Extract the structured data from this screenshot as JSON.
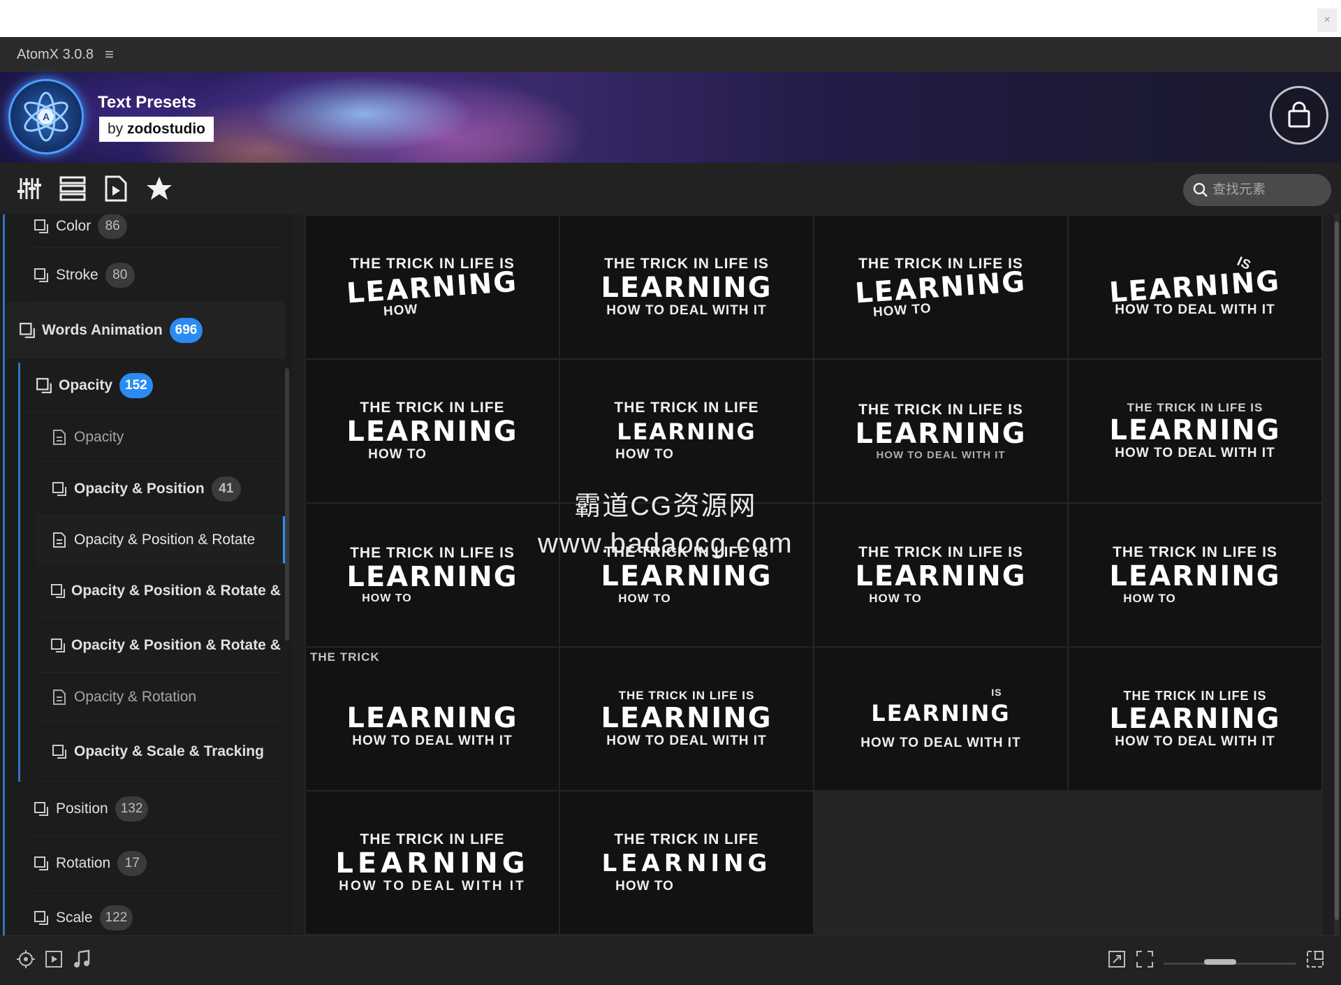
{
  "app": {
    "title": "AtomX 3.0.8",
    "menu_icon": "hamburger-icon"
  },
  "banner": {
    "title": "Text Presets",
    "by_prefix": "by",
    "author": "zodostudio",
    "logo_icon": "atom-logo-icon",
    "cart_icon": "shopping-bag-icon"
  },
  "toolbar": {
    "icons": [
      "sliders-icon",
      "list-icon",
      "file-play-icon",
      "star-icon"
    ],
    "search_placeholder": "查找元素"
  },
  "sidebar": {
    "items": [
      {
        "label": "Color",
        "count": "86"
      },
      {
        "label": "Stroke",
        "count": "80"
      },
      {
        "label": "Words Animation",
        "count": "696"
      },
      {
        "label": "Opacity",
        "count": "152"
      },
      {
        "label": "Opacity",
        "count": ""
      },
      {
        "label": "Opacity & Position",
        "count": "41"
      },
      {
        "label": "Opacity & Position & Rotate",
        "count": ""
      },
      {
        "label": "Opacity & Position & Rotate & ...",
        "count": ""
      },
      {
        "label": "Opacity & Position & Rotate & ...",
        "count": ""
      },
      {
        "label": "Opacity & Rotation",
        "count": ""
      },
      {
        "label": "Opacity & Scale & Tracking",
        "count": ""
      },
      {
        "label": "Position",
        "count": "132"
      },
      {
        "label": "Rotation",
        "count": "17"
      },
      {
        "label": "Scale",
        "count": "122"
      }
    ]
  },
  "gallery": {
    "line1": "THE TRICK IN LIFE IS",
    "line2": "LEARNING",
    "line3": "HOW TO DEAL WITH IT",
    "line1_short": "THE TRICK IN LIFE",
    "frag_how": "HOW",
    "frag_how_to": "HOW TO",
    "frag_is": "IS",
    "frag_the": "THE",
    "frag_the_trick": "THE TRICK"
  },
  "watermark": {
    "line1": "霸道CG资源网",
    "line2": "www.badaocg.com"
  },
  "bottombar": {
    "icons": [
      "target-icon",
      "play-box-icon",
      "music-note-icon",
      "expand-icon",
      "fullscreen-icon",
      "window-icon"
    ],
    "zoom_level": 0.4
  },
  "colors": {
    "accent": "#2a8bf2",
    "background": "#1e1e1e",
    "tile": "#121212"
  }
}
